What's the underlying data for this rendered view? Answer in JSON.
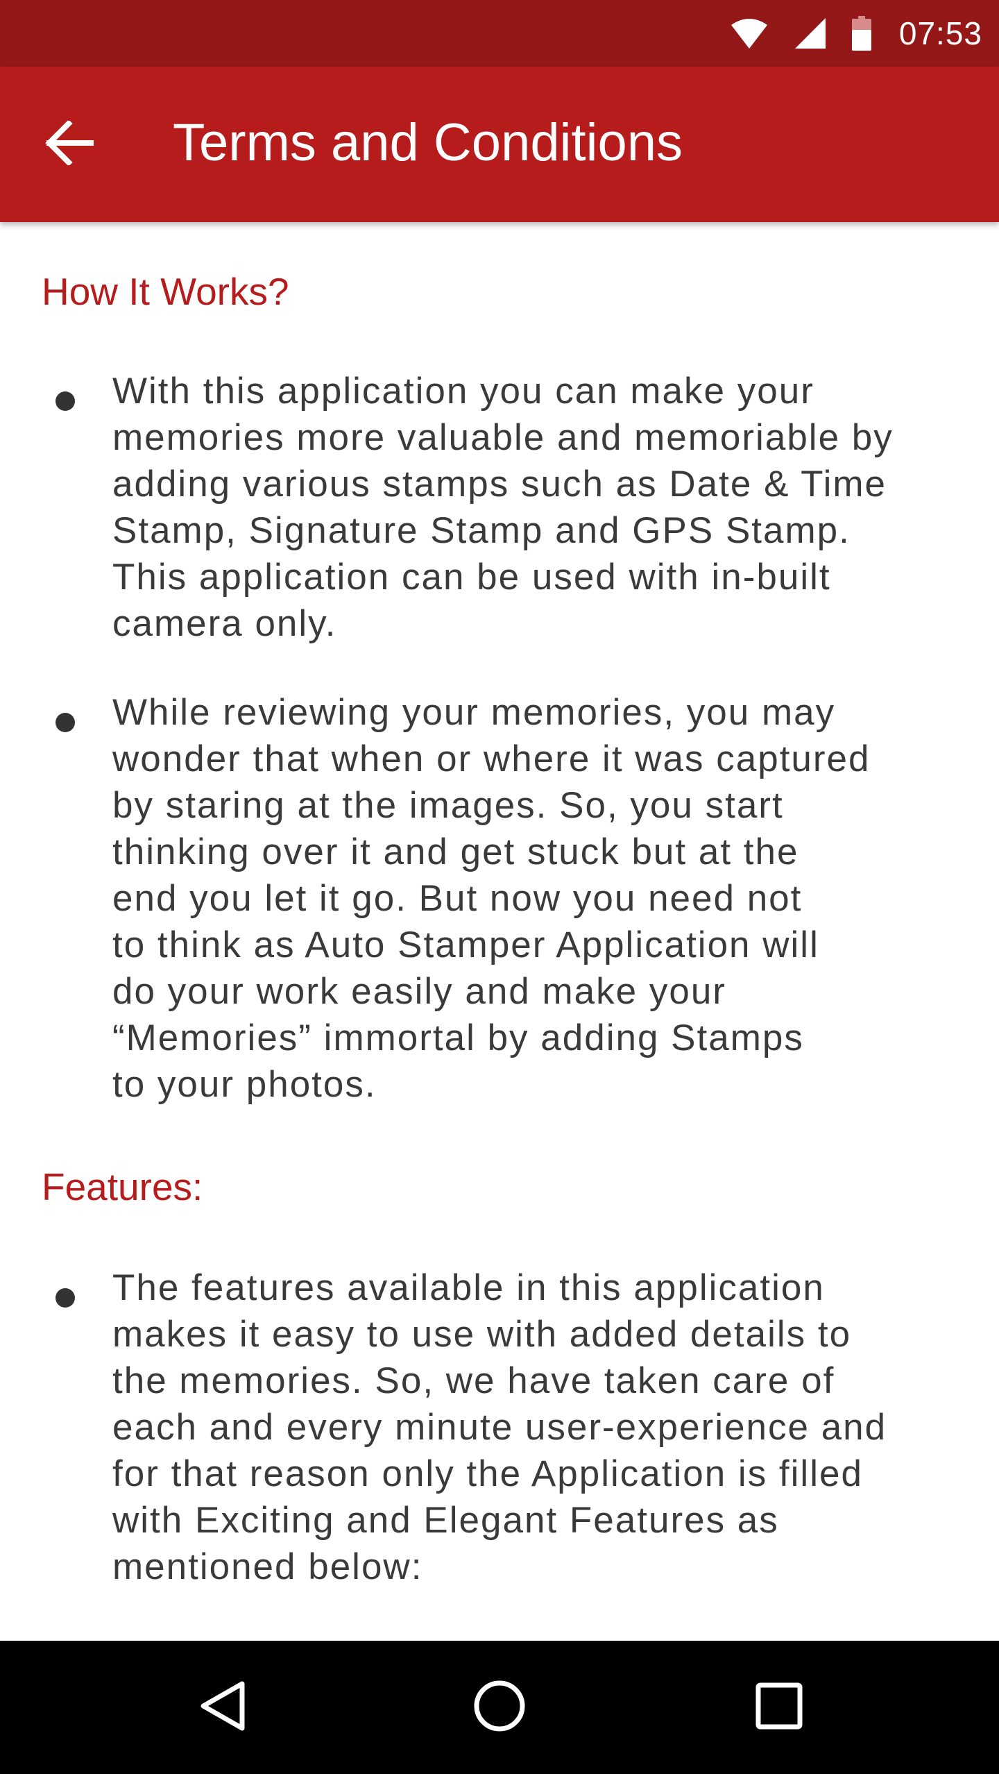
{
  "status_bar": {
    "time": "07:53",
    "icons": [
      "wifi-icon",
      "signal-icon",
      "battery-icon"
    ]
  },
  "app_bar": {
    "title": "Terms and Conditions",
    "back_icon": "arrow-back-icon",
    "color": "#b71c1c"
  },
  "sections": [
    {
      "heading": "How It Works?",
      "bullets": [
        {
          "lines": [
            "With this application you can make your",
            "memories more valuable and memoriable by",
            "adding various stamps such as Date & Time",
            "Stamp, Signature Stamp and GPS Stamp.",
            "This application can be used with in-built",
            "camera only."
          ]
        },
        {
          "lines": [
            "While reviewing your memories, you may",
            "wonder that when or where it was captured",
            "by staring at the images. So, you start",
            "thinking over it and get stuck but at the",
            "end you let it go. But now you need not",
            "to think as Auto Stamper Application will",
            "do your work easily and make your",
            "“Memories” immortal by adding Stamps",
            "to your photos."
          ]
        }
      ]
    },
    {
      "heading": "Features:",
      "bullets": [
        {
          "lines": [
            "The features available in this application",
            "makes it easy to use with added details to",
            "the memories. So, we have taken care of",
            "each and every minute user-experience and",
            "for that reason only the Application is filled",
            "with Exciting and Elegant Features as",
            "mentioned below:"
          ]
        }
      ]
    }
  ],
  "nav_bar": {
    "buttons": [
      "back-triangle-icon",
      "home-circle-icon",
      "recents-square-icon"
    ]
  },
  "colors": {
    "status_bar": "#941818",
    "accent": "#b71c1c",
    "body_text": "#3a3a3a"
  }
}
